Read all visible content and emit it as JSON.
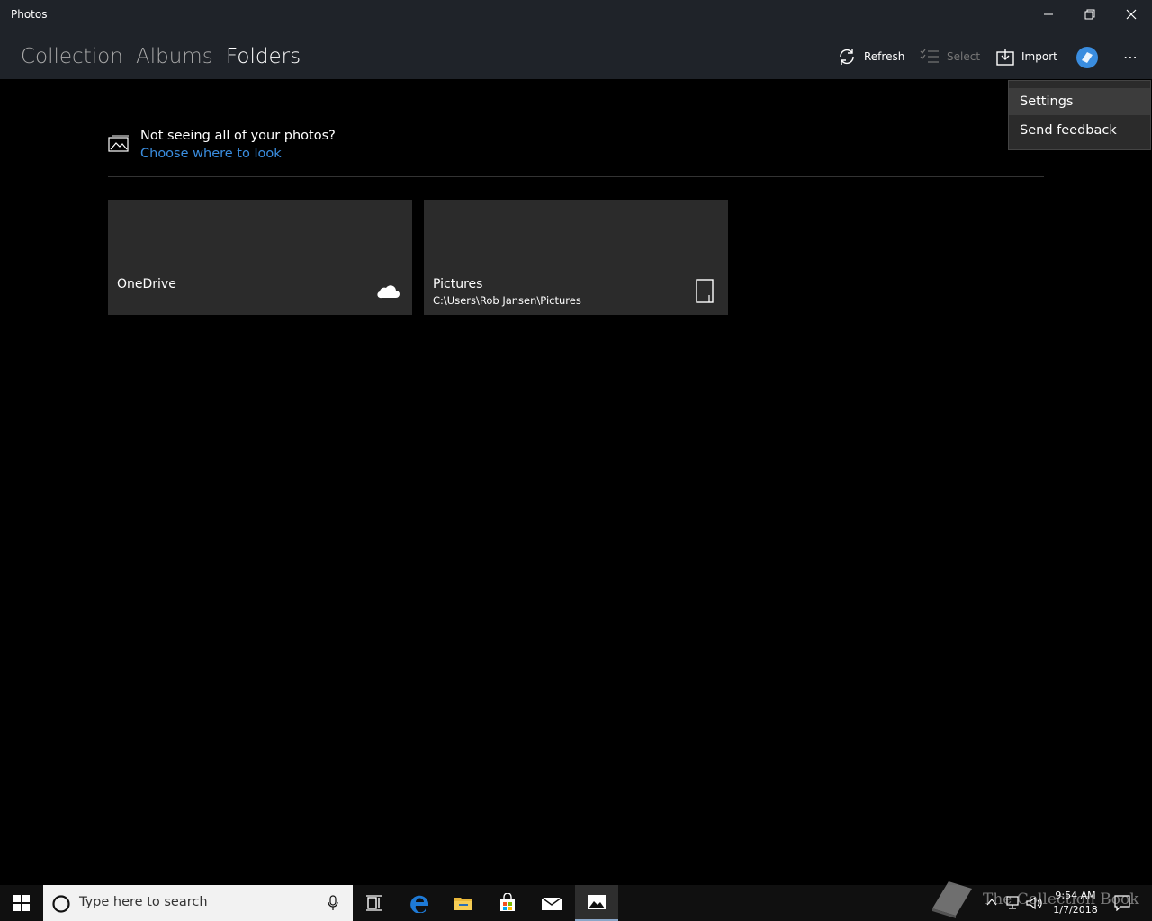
{
  "window": {
    "title": "Photos"
  },
  "nav": {
    "tabs": [
      {
        "label": "Collection"
      },
      {
        "label": "Albums"
      },
      {
        "label": "Folders"
      }
    ]
  },
  "toolbar": {
    "refresh_label": "Refresh",
    "select_label": "Select",
    "import_label": "Import"
  },
  "notice": {
    "text": "Not seeing all of your photos?",
    "link": "Choose where to look"
  },
  "folders": [
    {
      "name": "OneDrive",
      "icon": "cloud-icon"
    },
    {
      "name": "Pictures",
      "path": "C:\\Users\\Rob Jansen\\Pictures",
      "icon": "device-icon"
    }
  ],
  "menu": {
    "items": [
      {
        "label": "Settings"
      },
      {
        "label": "Send feedback"
      }
    ]
  },
  "taskbar": {
    "search_placeholder": "Type here to search",
    "time": "9:54 AM",
    "date": "1/7/2018"
  },
  "watermark": {
    "text": "The Collection Book"
  },
  "colors": {
    "header_bg": "#1f2329",
    "accent_link": "#3a8ddf",
    "tile_bg": "#2b2b2b"
  }
}
